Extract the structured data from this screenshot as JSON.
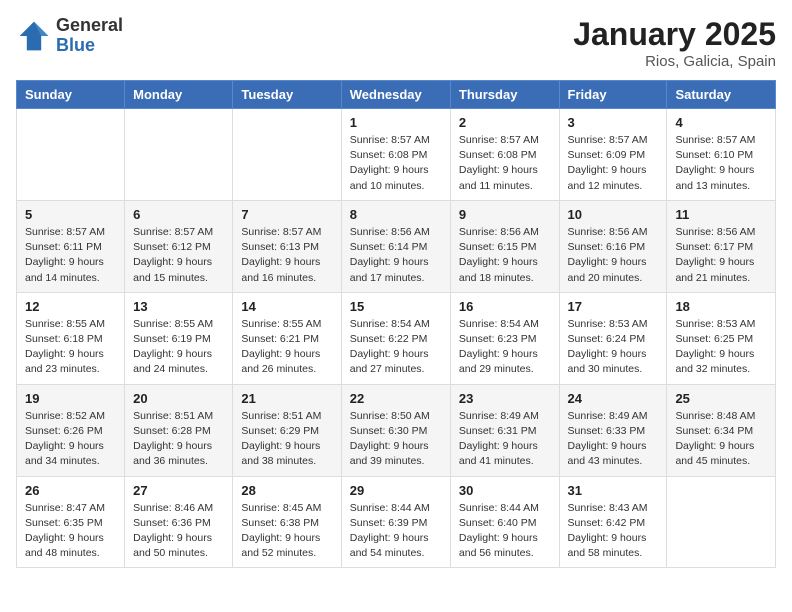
{
  "logo": {
    "general": "General",
    "blue": "Blue"
  },
  "title": {
    "month": "January 2025",
    "location": "Rios, Galicia, Spain"
  },
  "weekdays": [
    "Sunday",
    "Monday",
    "Tuesday",
    "Wednesday",
    "Thursday",
    "Friday",
    "Saturday"
  ],
  "weeks": [
    [
      {
        "day": "",
        "info": ""
      },
      {
        "day": "",
        "info": ""
      },
      {
        "day": "",
        "info": ""
      },
      {
        "day": "1",
        "info": "Sunrise: 8:57 AM\nSunset: 6:08 PM\nDaylight: 9 hours and 10 minutes."
      },
      {
        "day": "2",
        "info": "Sunrise: 8:57 AM\nSunset: 6:08 PM\nDaylight: 9 hours and 11 minutes."
      },
      {
        "day": "3",
        "info": "Sunrise: 8:57 AM\nSunset: 6:09 PM\nDaylight: 9 hours and 12 minutes."
      },
      {
        "day": "4",
        "info": "Sunrise: 8:57 AM\nSunset: 6:10 PM\nDaylight: 9 hours and 13 minutes."
      }
    ],
    [
      {
        "day": "5",
        "info": "Sunrise: 8:57 AM\nSunset: 6:11 PM\nDaylight: 9 hours and 14 minutes."
      },
      {
        "day": "6",
        "info": "Sunrise: 8:57 AM\nSunset: 6:12 PM\nDaylight: 9 hours and 15 minutes."
      },
      {
        "day": "7",
        "info": "Sunrise: 8:57 AM\nSunset: 6:13 PM\nDaylight: 9 hours and 16 minutes."
      },
      {
        "day": "8",
        "info": "Sunrise: 8:56 AM\nSunset: 6:14 PM\nDaylight: 9 hours and 17 minutes."
      },
      {
        "day": "9",
        "info": "Sunrise: 8:56 AM\nSunset: 6:15 PM\nDaylight: 9 hours and 18 minutes."
      },
      {
        "day": "10",
        "info": "Sunrise: 8:56 AM\nSunset: 6:16 PM\nDaylight: 9 hours and 20 minutes."
      },
      {
        "day": "11",
        "info": "Sunrise: 8:56 AM\nSunset: 6:17 PM\nDaylight: 9 hours and 21 minutes."
      }
    ],
    [
      {
        "day": "12",
        "info": "Sunrise: 8:55 AM\nSunset: 6:18 PM\nDaylight: 9 hours and 23 minutes."
      },
      {
        "day": "13",
        "info": "Sunrise: 8:55 AM\nSunset: 6:19 PM\nDaylight: 9 hours and 24 minutes."
      },
      {
        "day": "14",
        "info": "Sunrise: 8:55 AM\nSunset: 6:21 PM\nDaylight: 9 hours and 26 minutes."
      },
      {
        "day": "15",
        "info": "Sunrise: 8:54 AM\nSunset: 6:22 PM\nDaylight: 9 hours and 27 minutes."
      },
      {
        "day": "16",
        "info": "Sunrise: 8:54 AM\nSunset: 6:23 PM\nDaylight: 9 hours and 29 minutes."
      },
      {
        "day": "17",
        "info": "Sunrise: 8:53 AM\nSunset: 6:24 PM\nDaylight: 9 hours and 30 minutes."
      },
      {
        "day": "18",
        "info": "Sunrise: 8:53 AM\nSunset: 6:25 PM\nDaylight: 9 hours and 32 minutes."
      }
    ],
    [
      {
        "day": "19",
        "info": "Sunrise: 8:52 AM\nSunset: 6:26 PM\nDaylight: 9 hours and 34 minutes."
      },
      {
        "day": "20",
        "info": "Sunrise: 8:51 AM\nSunset: 6:28 PM\nDaylight: 9 hours and 36 minutes."
      },
      {
        "day": "21",
        "info": "Sunrise: 8:51 AM\nSunset: 6:29 PM\nDaylight: 9 hours and 38 minutes."
      },
      {
        "day": "22",
        "info": "Sunrise: 8:50 AM\nSunset: 6:30 PM\nDaylight: 9 hours and 39 minutes."
      },
      {
        "day": "23",
        "info": "Sunrise: 8:49 AM\nSunset: 6:31 PM\nDaylight: 9 hours and 41 minutes."
      },
      {
        "day": "24",
        "info": "Sunrise: 8:49 AM\nSunset: 6:33 PM\nDaylight: 9 hours and 43 minutes."
      },
      {
        "day": "25",
        "info": "Sunrise: 8:48 AM\nSunset: 6:34 PM\nDaylight: 9 hours and 45 minutes."
      }
    ],
    [
      {
        "day": "26",
        "info": "Sunrise: 8:47 AM\nSunset: 6:35 PM\nDaylight: 9 hours and 48 minutes."
      },
      {
        "day": "27",
        "info": "Sunrise: 8:46 AM\nSunset: 6:36 PM\nDaylight: 9 hours and 50 minutes."
      },
      {
        "day": "28",
        "info": "Sunrise: 8:45 AM\nSunset: 6:38 PM\nDaylight: 9 hours and 52 minutes."
      },
      {
        "day": "29",
        "info": "Sunrise: 8:44 AM\nSunset: 6:39 PM\nDaylight: 9 hours and 54 minutes."
      },
      {
        "day": "30",
        "info": "Sunrise: 8:44 AM\nSunset: 6:40 PM\nDaylight: 9 hours and 56 minutes."
      },
      {
        "day": "31",
        "info": "Sunrise: 8:43 AM\nSunset: 6:42 PM\nDaylight: 9 hours and 58 minutes."
      },
      {
        "day": "",
        "info": ""
      }
    ]
  ]
}
